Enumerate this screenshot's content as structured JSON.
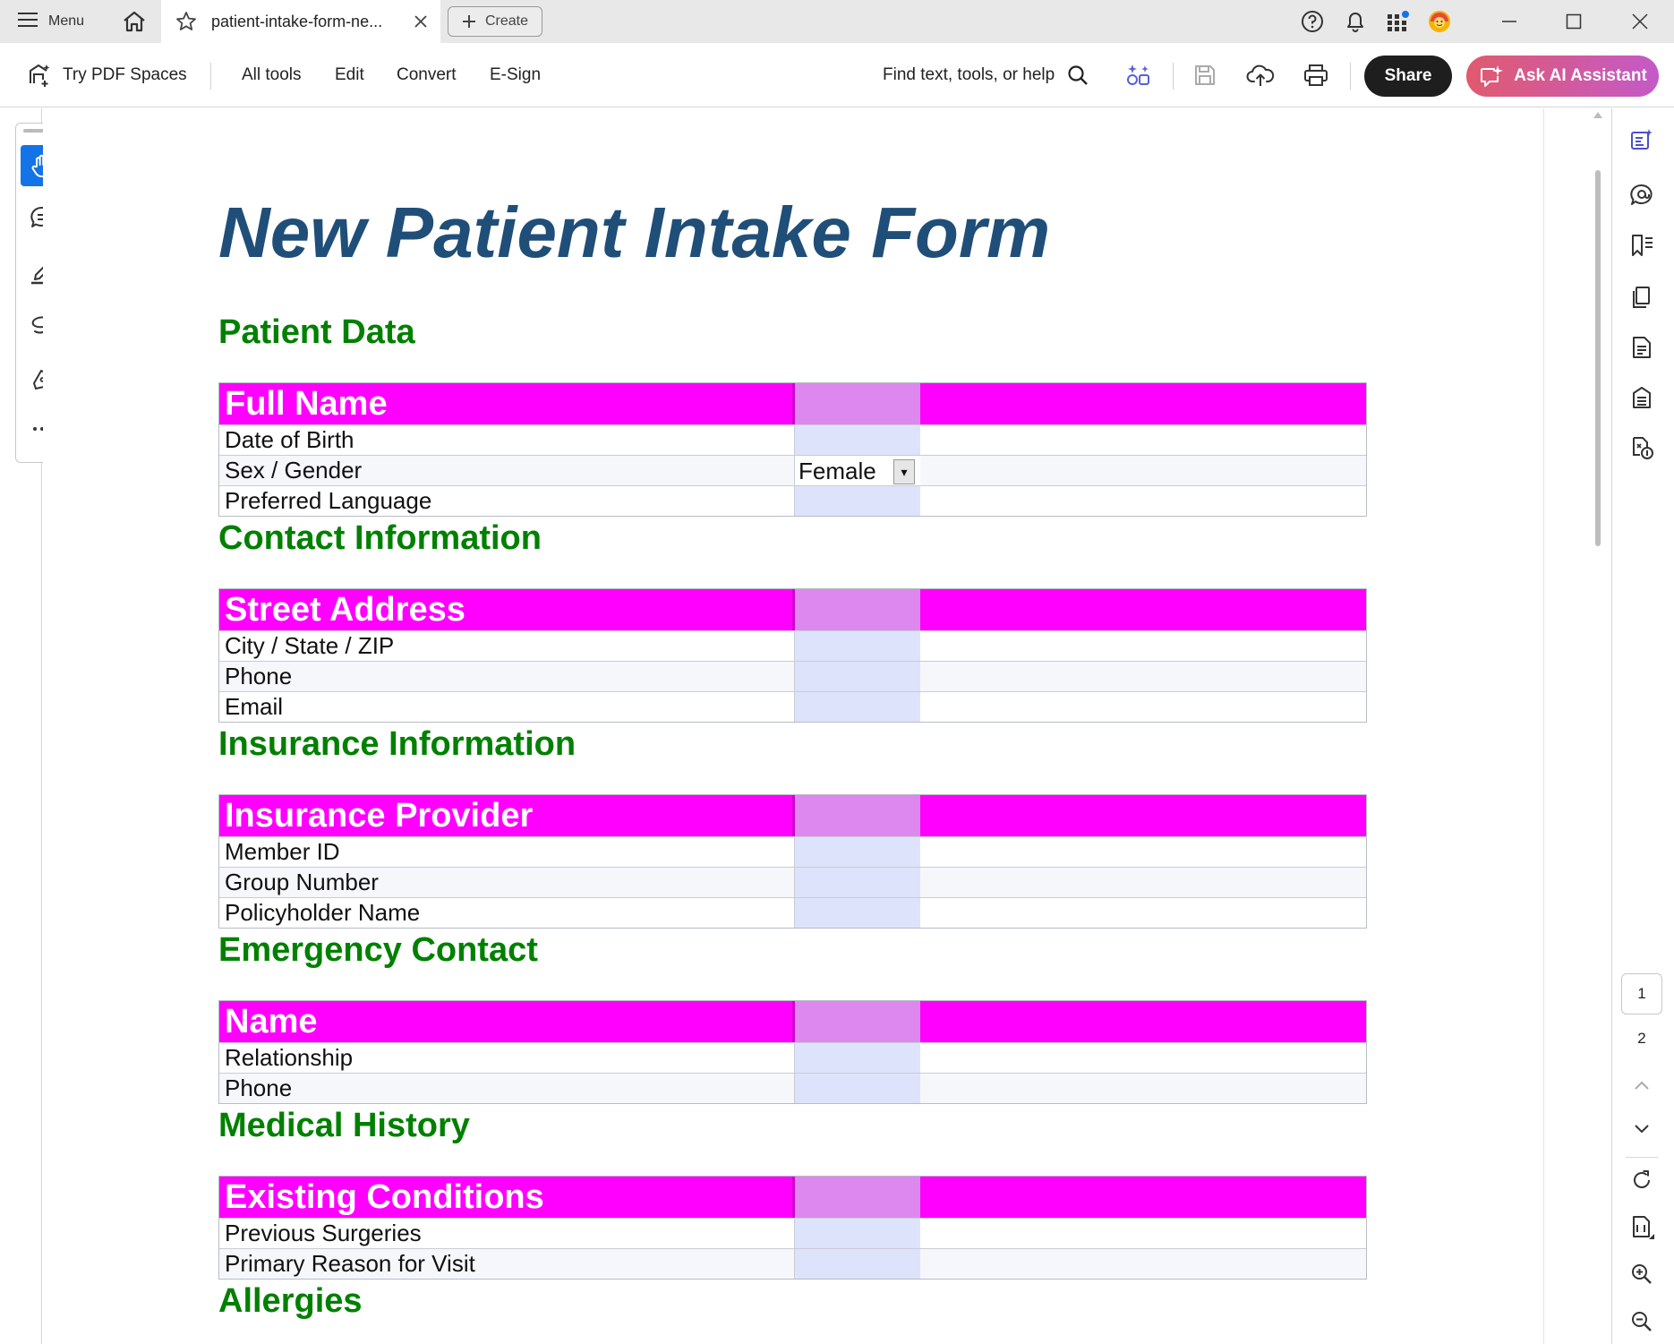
{
  "titlebar": {
    "menu_label": "Menu",
    "tab_title": "patient-intake-form-ne...",
    "create_label": "Create"
  },
  "toolbar": {
    "spaces_label": "Try PDF Spaces",
    "menus": [
      "All tools",
      "Edit",
      "Convert",
      "E-Sign"
    ],
    "find_label": "Find text, tools, or help",
    "share_label": "Share",
    "ai_label": "Ask AI Assistant"
  },
  "document": {
    "title": "New Patient Intake Form",
    "sections": [
      {
        "title": "Patient Data",
        "header": "Full Name",
        "rows": [
          "Date of Birth",
          "Sex / Gender",
          "Preferred Language"
        ]
      },
      {
        "title": "Contact Information",
        "header": "Street Address",
        "rows": [
          "City / State / ZIP",
          "Phone",
          "Email"
        ]
      },
      {
        "title": "Insurance Information",
        "header": "Insurance Provider",
        "rows": [
          "Member ID",
          "Group Number",
          "Policyholder Name"
        ]
      },
      {
        "title": "Emergency Contact",
        "header": "Name",
        "rows": [
          "Relationship",
          "Phone"
        ]
      },
      {
        "title": "Medical History",
        "header": "Existing Conditions",
        "rows": [
          "Previous Surgeries",
          "Primary Reason for Visit"
        ]
      },
      {
        "title": "Allergies"
      }
    ],
    "gender_value": "Female"
  },
  "pages": {
    "current": "1",
    "next": "2"
  },
  "colors": {
    "title_blue": "#1f4e79",
    "section_green": "#008000",
    "header_magenta": "#ff00ff",
    "field_highlight": "#dde3fb",
    "accent_blue": "#1473e6"
  },
  "icons": {
    "left_tools": [
      "hand-icon",
      "comment-icon",
      "highlight-pen-icon",
      "draw-freeform-icon",
      "sign-pen-icon",
      "more-icon"
    ],
    "right_rail": [
      "edit-pdf-icon",
      "comments-panel-icon",
      "bookmarks-icon",
      "pages-icon",
      "document-icon",
      "protect-icon",
      "accessibility-icon"
    ]
  }
}
